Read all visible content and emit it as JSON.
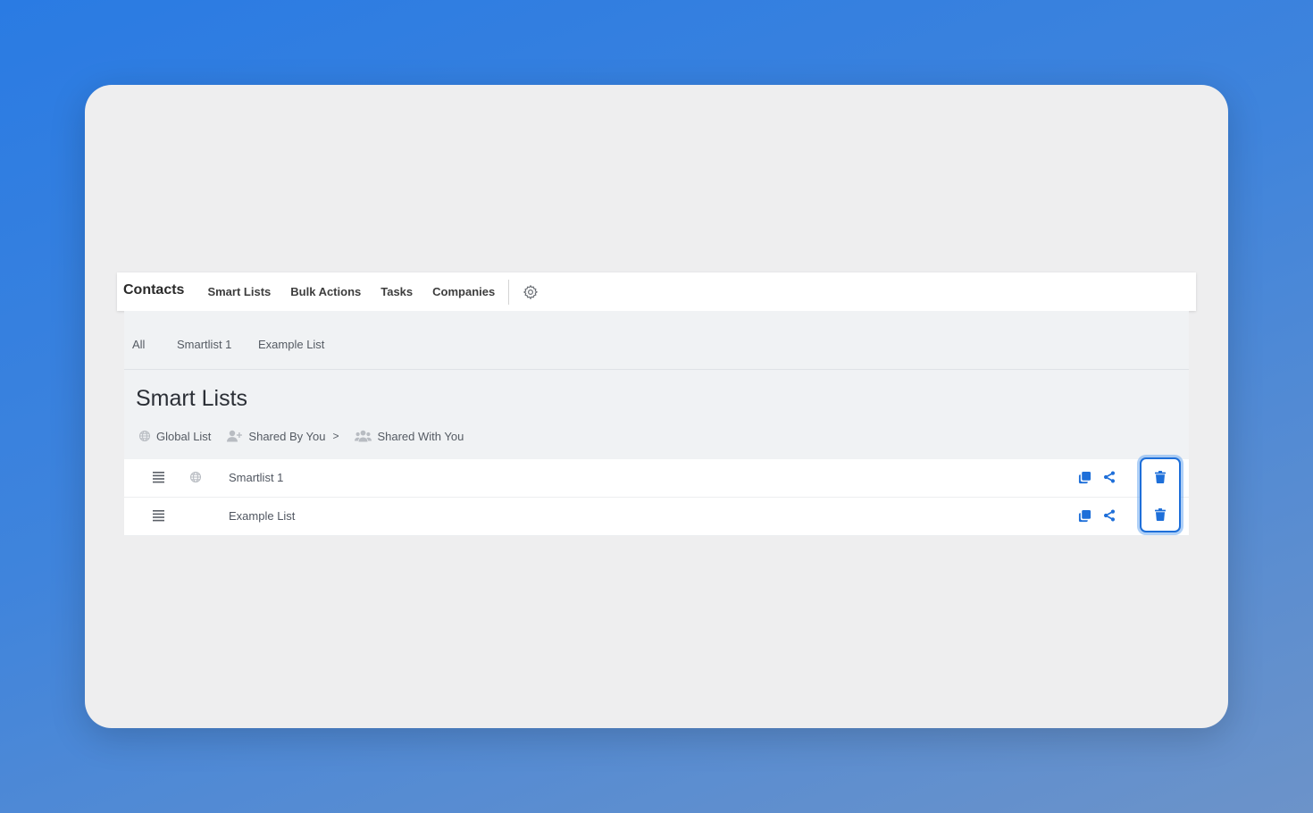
{
  "topnav": {
    "brand": "Contacts",
    "items": [
      "Smart Lists",
      "Bulk Actions",
      "Tasks",
      "Companies"
    ],
    "settings_icon": "gear-icon"
  },
  "subtabs": [
    "All",
    "Smartlist 1",
    "Example List"
  ],
  "page": {
    "title": "Smart Lists"
  },
  "filters": {
    "global": {
      "label": "Global List",
      "icon": "globe-icon"
    },
    "shared_by_you": {
      "label": "Shared By You",
      "icon": "user-plus-icon",
      "chevron": ">"
    },
    "shared_with_you": {
      "label": "Shared With You",
      "icon": "users-icon"
    }
  },
  "lists": [
    {
      "name": "Smartlist 1",
      "global": true
    },
    {
      "name": "Example List",
      "global": false
    }
  ],
  "colors": {
    "accent": "#1e6fd9",
    "icon_gray": "#b8bcc2"
  }
}
